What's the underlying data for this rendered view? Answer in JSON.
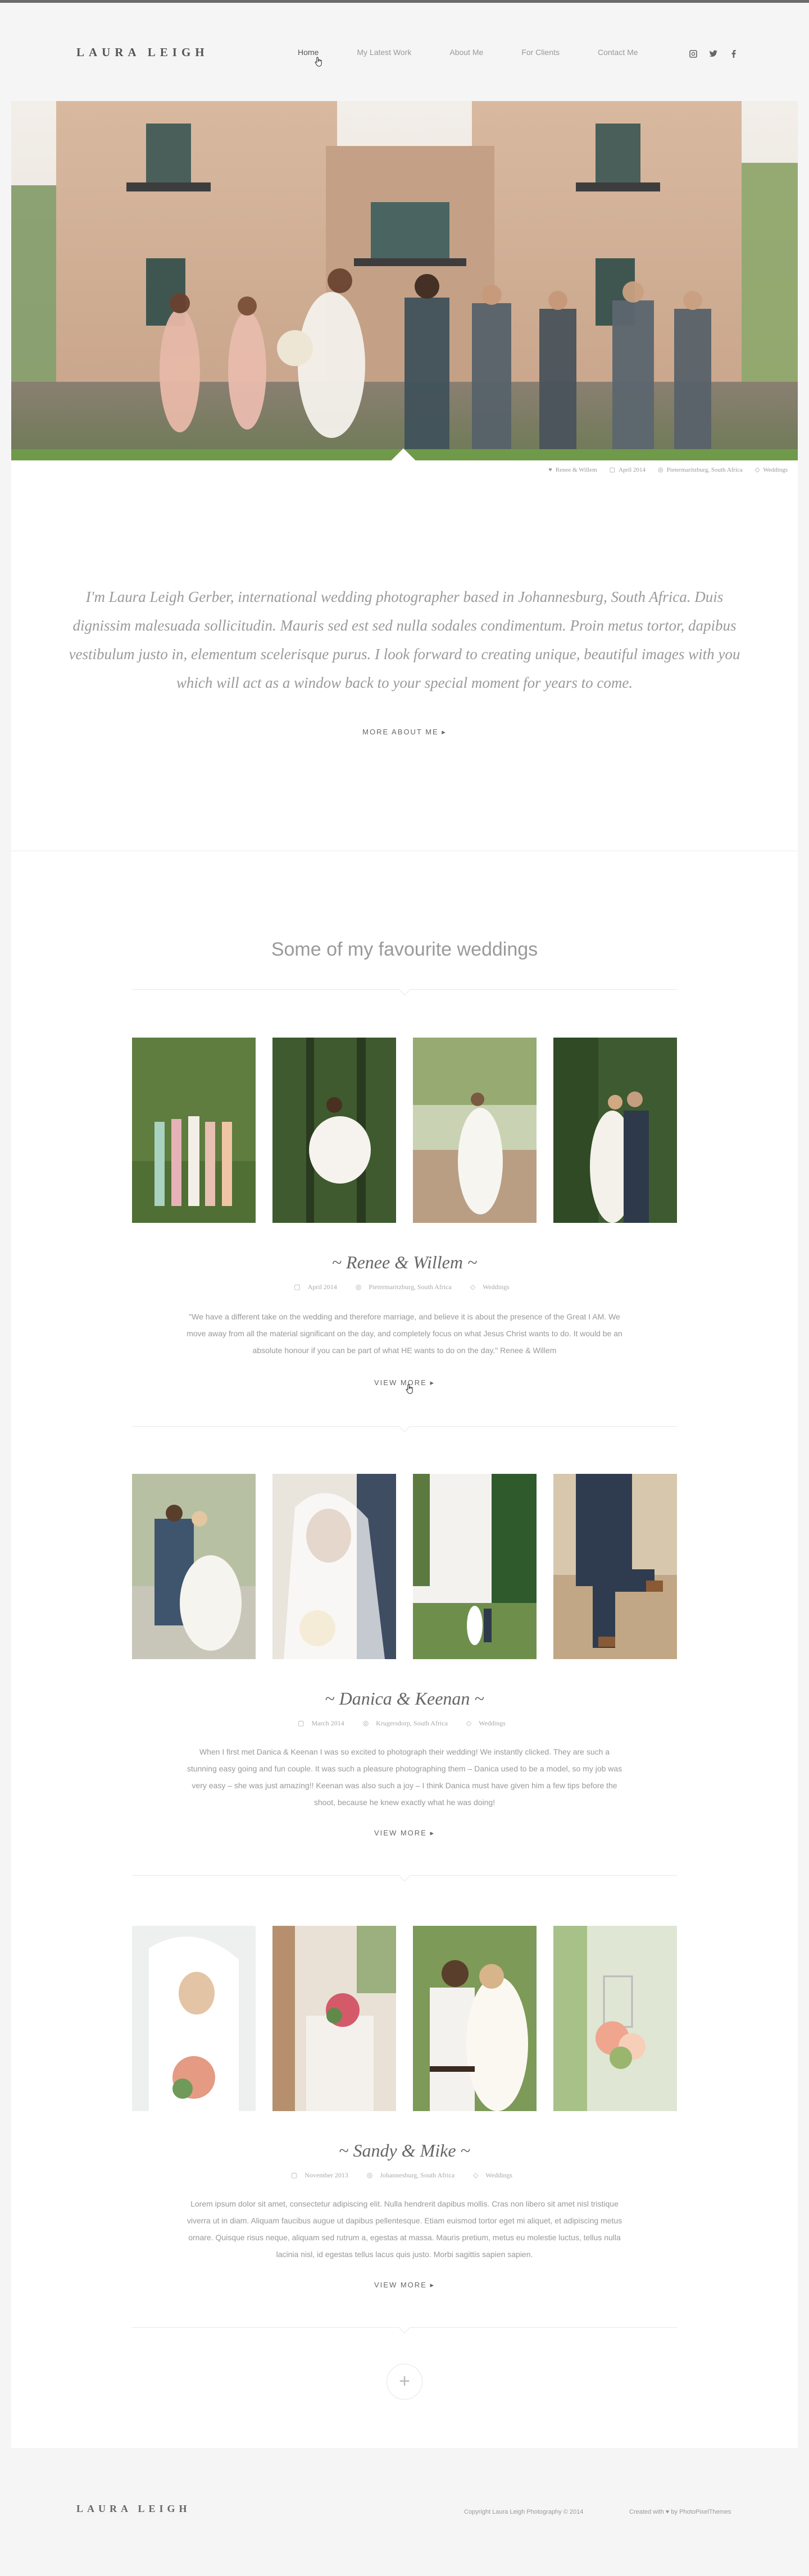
{
  "header": {
    "logo": "LAURA LEIGH",
    "nav": [
      "Home",
      "My Latest Work",
      "About Me",
      "For Clients",
      "Contact Me"
    ],
    "social_icons": [
      "instagram-icon",
      "twitter-icon",
      "facebook-icon"
    ]
  },
  "hero": {
    "meta": {
      "couple": "Renee & Willem",
      "date": "April 2014",
      "location": "Pietermaritzburg, South Africa",
      "category": "Weddings"
    }
  },
  "intro": {
    "text": "I'm Laura Leigh Gerber, international wedding photographer based in Johannesburg, South Africa. Duis dignissim malesuada sollicitudin. Mauris sed est sed nulla sodales condimentum. Proin metus tortor, dapibus vestibulum justo in, elementum scelerisque purus. I look forward to creating unique, beautiful images with you which will act as a window back to your special moment for years to come.",
    "link": "MORE ABOUT ME ▸"
  },
  "section": {
    "title": "Some of my favourite weddings"
  },
  "weddings": [
    {
      "title": "~ Renee & Willem ~",
      "date": "April 2014",
      "location": "Pietermaritzburg, South Africa",
      "category": "Weddings",
      "text": "\"We have a different take on the wedding and therefore marriage, and believe it is about the presence of the Great I AM. We move away from all the material significant on the day, and completely focus on what Jesus Christ wants to do. It would be an absolute honour if you can be part of what HE wants to do on the day.\" Renee & Willem",
      "link": "VIEW MORE ▸"
    },
    {
      "title": "~ Danica & Keenan ~",
      "date": "March 2014",
      "location": "Krugersdorp, South Africa",
      "category": "Weddings",
      "text": "When I first met Danica & Keenan I was so excited to photograph their wedding! We instantly clicked. They are such a stunning easy going and fun couple. It was such a pleasure photographing them – Danica used to be a model, so my job was very easy – she was just amazing!! Keenan was also such a joy – I think Danica must have given him a few tips before the shoot, because he knew exactly what he was doing!",
      "link": "VIEW MORE ▸"
    },
    {
      "title": "~ Sandy & Mike ~",
      "date": "November 2013",
      "location": "Johannesburg, South Africa",
      "category": "Weddings",
      "text": "Lorem ipsum dolor sit amet, consectetur adipiscing elit. Nulla hendrerit dapibus mollis. Cras non libero sit amet nisl tristique viverra ut in diam. Aliquam faucibus augue ut dapibus pellentesque. Etiam euismod tortor eget mi aliquet, et adipiscing metus ornare. Quisque risus neque, aliquam sed rutrum a, egestas at massa. Mauris pretium, metus eu molestie luctus, tellus nulla lacinia nisl, id egestas tellus lacus quis justo. Morbi sagittis sapien sapien.",
      "link": "VIEW MORE ▸"
    }
  ],
  "load_more": "+",
  "footer": {
    "logo": "LAURA LEIGH",
    "copyright": "Copyright Laura Leigh Photography © 2014",
    "credit": "Created with ♥ by PhotoPixelThemes"
  }
}
